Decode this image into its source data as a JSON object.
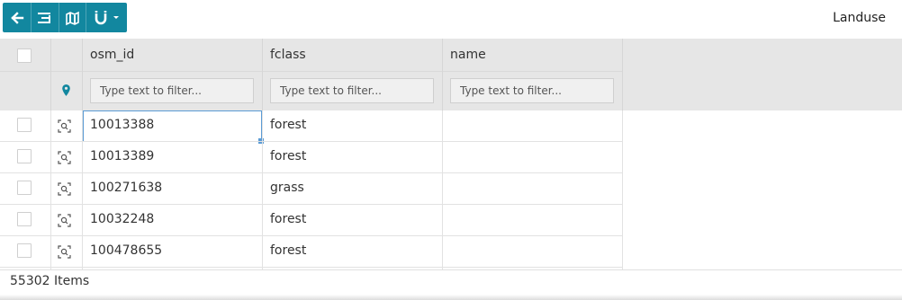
{
  "toolbar": {
    "buttons": [
      {
        "name": "back-button",
        "icon": "arrow-left-icon"
      },
      {
        "name": "filter-list-button",
        "icon": "filter-list-icon"
      },
      {
        "name": "sync-map-button",
        "icon": "map-sync-icon"
      },
      {
        "name": "magnet-dropdown-button",
        "icon": "magnet-icon"
      }
    ],
    "accent_color": "#12879f"
  },
  "layer_title": "Landuse",
  "columns": [
    {
      "key": "osm_id",
      "label": "osm_id",
      "filter_placeholder": "Type text to filter..."
    },
    {
      "key": "fclass",
      "label": "fclass",
      "filter_placeholder": "Type text to filter..."
    },
    {
      "key": "name",
      "label": "name",
      "filter_placeholder": "Type text to filter..."
    }
  ],
  "rows": [
    {
      "osm_id": "10013388",
      "fclass": "forest",
      "name": ""
    },
    {
      "osm_id": "10013389",
      "fclass": "forest",
      "name": ""
    },
    {
      "osm_id": "100271638",
      "fclass": "grass",
      "name": ""
    },
    {
      "osm_id": "10032248",
      "fclass": "forest",
      "name": ""
    },
    {
      "osm_id": "100478655",
      "fclass": "forest",
      "name": ""
    }
  ],
  "footer": {
    "count_text": "55302 Items"
  }
}
